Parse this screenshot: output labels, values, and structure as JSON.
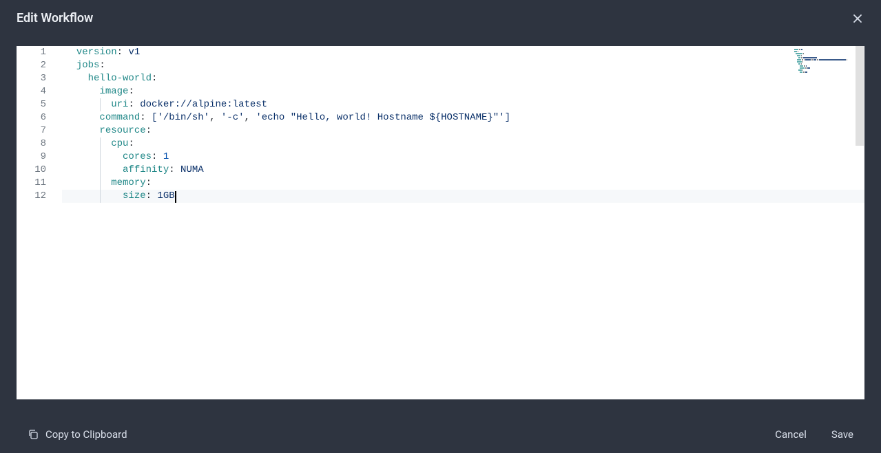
{
  "header": {
    "title": "Edit Workflow"
  },
  "editor": {
    "lineNumbers": [
      "1",
      "2",
      "3",
      "4",
      "5",
      "6",
      "7",
      "8",
      "9",
      "10",
      "11",
      "12"
    ],
    "activeLine": 12,
    "lines": [
      [
        {
          "t": "ind",
          "w": 1
        },
        {
          "t": "key",
          "v": "version"
        },
        {
          "t": "colon",
          "v": ": "
        },
        {
          "t": "str",
          "v": "v1"
        }
      ],
      [
        {
          "t": "ind",
          "w": 1
        },
        {
          "t": "key",
          "v": "jobs"
        },
        {
          "t": "colon",
          "v": ":"
        }
      ],
      [
        {
          "t": "ind",
          "w": 2
        },
        {
          "t": "key",
          "v": "hello-world"
        },
        {
          "t": "colon",
          "v": ":"
        }
      ],
      [
        {
          "t": "ind",
          "w": 3
        },
        {
          "t": "key",
          "v": "image"
        },
        {
          "t": "colon",
          "v": ":"
        }
      ],
      [
        {
          "t": "ind",
          "w": 4,
          "g": [
            3
          ]
        },
        {
          "t": "key",
          "v": "uri"
        },
        {
          "t": "colon",
          "v": ": "
        },
        {
          "t": "str",
          "v": "docker://alpine:latest"
        }
      ],
      [
        {
          "t": "ind",
          "w": 3
        },
        {
          "t": "key",
          "v": "command"
        },
        {
          "t": "colon",
          "v": ": "
        },
        {
          "t": "bracket",
          "v": "["
        },
        {
          "t": "str",
          "v": "'/bin/sh'"
        },
        {
          "t": "comma",
          "v": ", "
        },
        {
          "t": "str",
          "v": "'-c'"
        },
        {
          "t": "comma",
          "v": ", "
        },
        {
          "t": "str",
          "v": "'echo \"Hello, world! Hostname ${HOSTNAME}\"'"
        },
        {
          "t": "bracket",
          "v": "]"
        }
      ],
      [
        {
          "t": "ind",
          "w": 3
        },
        {
          "t": "key",
          "v": "resource"
        },
        {
          "t": "colon",
          "v": ":"
        }
      ],
      [
        {
          "t": "ind",
          "w": 4,
          "g": [
            3
          ]
        },
        {
          "t": "key",
          "v": "cpu"
        },
        {
          "t": "colon",
          "v": ":"
        }
      ],
      [
        {
          "t": "ind",
          "w": 5,
          "g": [
            3
          ]
        },
        {
          "t": "key",
          "v": "cores"
        },
        {
          "t": "colon",
          "v": ": "
        },
        {
          "t": "num",
          "v": "1"
        }
      ],
      [
        {
          "t": "ind",
          "w": 5,
          "g": [
            3
          ]
        },
        {
          "t": "key",
          "v": "affinity"
        },
        {
          "t": "colon",
          "v": ": "
        },
        {
          "t": "str",
          "v": "NUMA"
        }
      ],
      [
        {
          "t": "ind",
          "w": 4,
          "g": [
            3
          ]
        },
        {
          "t": "key",
          "v": "memory"
        },
        {
          "t": "colon",
          "v": ":"
        }
      ],
      [
        {
          "t": "ind",
          "w": 5,
          "g": [
            3
          ]
        },
        {
          "t": "key",
          "v": "size"
        },
        {
          "t": "colon",
          "v": ": "
        },
        {
          "t": "str",
          "v": "1GB"
        },
        {
          "t": "cursor"
        }
      ]
    ]
  },
  "footer": {
    "copy_label": "Copy to Clipboard",
    "cancel_label": "Cancel",
    "save_label": "Save"
  }
}
